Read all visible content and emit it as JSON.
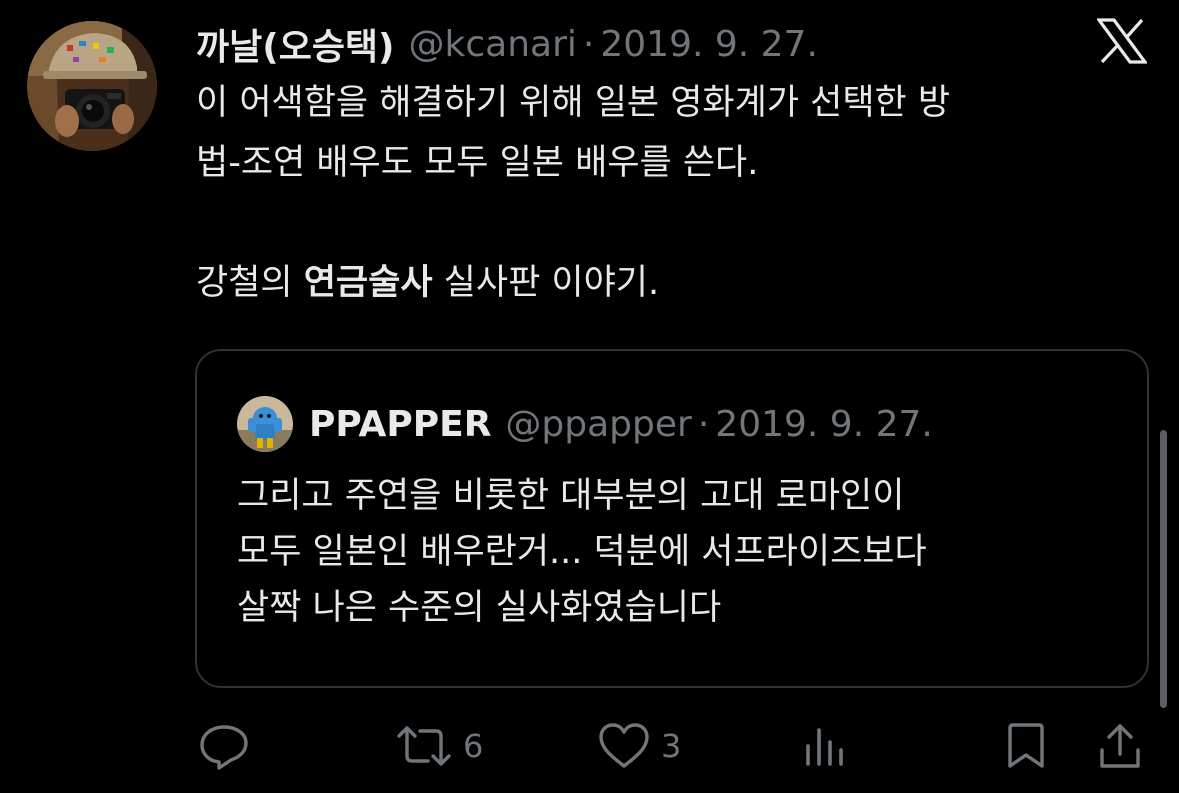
{
  "tweet": {
    "author": {
      "display_name": "까날(오승택)",
      "handle": "@kcanari",
      "avatar_icon": "photographer-avatar"
    },
    "separator": "·",
    "date": "2019. 9. 27.",
    "text": {
      "line1": "이 어색함을 해결하기 위해 일본 영화계가 선택한 방",
      "line2": "법-조연 배우도 모두 일본 배우를 쓴다.",
      "line3_prefix": "강철의 ",
      "line3_bold": "연금술사",
      "line3_suffix": " 실사판 이야기."
    }
  },
  "quoted_tweet": {
    "author": {
      "display_name": "PPAPPER",
      "handle": "@ppapper",
      "avatar_icon": "blue-figure-avatar"
    },
    "separator": "·",
    "date": "2019. 9. 27.",
    "text": {
      "line1": "그리고 주연을 비롯한 대부분의 고대 로마인이",
      "line2": "모두 일본인 배우란거... 덕분에 서프라이즈보다",
      "line3": "살짝 나은 수준의 실사화였습니다"
    }
  },
  "actions": {
    "reply": {
      "icon": "reply-icon",
      "count": ""
    },
    "retweet": {
      "icon": "retweet-icon",
      "count": "6"
    },
    "like": {
      "icon": "heart-icon",
      "count": "3"
    },
    "views": {
      "icon": "views-icon",
      "count": ""
    },
    "bookmark": {
      "icon": "bookmark-icon"
    },
    "share": {
      "icon": "share-icon"
    }
  },
  "brand": {
    "logo_icon": "x-logo-icon"
  },
  "colors": {
    "background": "#000000",
    "primary_text": "#e7e9ea",
    "secondary_text": "#71767b",
    "quote_border": "#2f3336"
  }
}
